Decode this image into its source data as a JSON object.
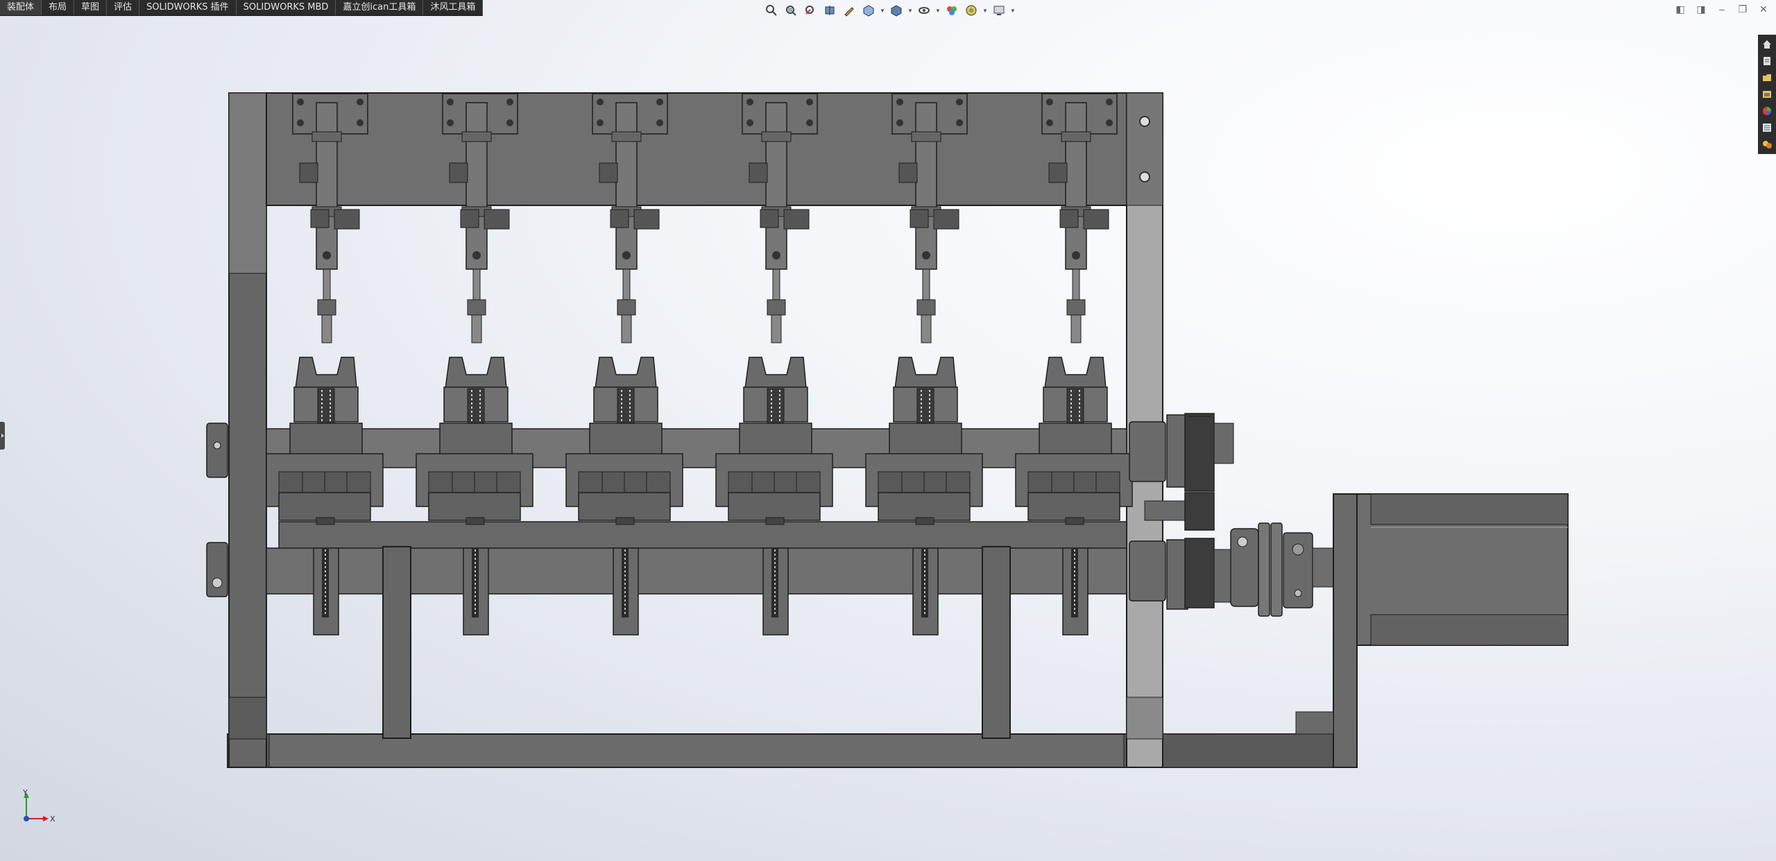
{
  "tabs": [
    {
      "label": "装配体",
      "active": true
    },
    {
      "label": "布局",
      "active": false
    },
    {
      "label": "草图",
      "active": false
    },
    {
      "label": "评估",
      "active": false
    },
    {
      "label": "SOLIDWORKS 插件",
      "active": false
    },
    {
      "label": "SOLIDWORKS MBD",
      "active": false
    },
    {
      "label": "嘉立创ican工具箱",
      "active": false
    },
    {
      "label": "沐风工具箱",
      "active": false
    }
  ],
  "hud_icons": [
    "zoom-to-fit-icon",
    "zoom-to-area-icon",
    "previous-view-icon",
    "section-view-icon",
    "dynamic-annotation-icon",
    "view-orientation-icon",
    "display-style-icon",
    "hide-show-items-icon",
    "edit-appearance-icon",
    "apply-scene-icon",
    "view-settings-icon"
  ],
  "window_controls": [
    "◧",
    "◨",
    "–",
    "❐",
    "✕"
  ],
  "task_pane_icons": [
    "home-icon",
    "resources-icon",
    "design-library-icon",
    "file-explorer-icon",
    "appearances-icon",
    "custom-properties-icon",
    "solidworks-forum-icon"
  ],
  "triad": {
    "x_label": "X",
    "y_label": "Y"
  },
  "colors": {
    "part_fill": "#6e6e6e",
    "part_dark": "#505050",
    "edge": "#1e1e1e",
    "light_part": "#a8a8a8"
  }
}
